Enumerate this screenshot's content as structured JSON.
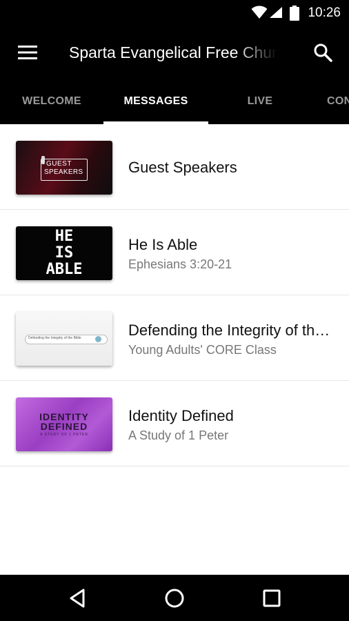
{
  "status_bar": {
    "time": "10:26",
    "icons": [
      "wifi-icon",
      "signal-icon",
      "battery-icon"
    ]
  },
  "app_bar": {
    "title": "Sparta Evangelical Free Church",
    "menu_icon": "menu-icon",
    "search_icon": "search-icon"
  },
  "tabs": [
    {
      "label": "WELCOME",
      "active": false
    },
    {
      "label": "MESSAGES",
      "active": true
    },
    {
      "label": "LIVE",
      "active": false
    },
    {
      "label": "CON",
      "active": false
    }
  ],
  "messages": [
    {
      "title": "Guest Speakers",
      "subtitle": "",
      "thumbnail_text": [
        "GUEST",
        "SPEAKERS"
      ]
    },
    {
      "title": "He Is Able",
      "subtitle": "Ephesians 3:20-21",
      "thumbnail_text": [
        "HE",
        "IS",
        "ABLE"
      ]
    },
    {
      "title": "Defending the Integrity of the Bible",
      "subtitle": "Young Adults' CORE Class",
      "thumbnail_text": [
        "Defending the Integrity of the Bible"
      ]
    },
    {
      "title": "Identity Defined",
      "subtitle": "A Study of 1 Peter",
      "thumbnail_text": [
        "IDENTITY",
        "DEFINED",
        "A STUDY OF 1 PETER"
      ]
    }
  ],
  "nav_bar": {
    "icons": [
      "back-icon",
      "home-icon",
      "recents-icon"
    ]
  },
  "colors": {
    "bar_background": "#000000",
    "tab_inactive": "#9a9a9a",
    "tab_active": "#ffffff",
    "subtitle": "#777777",
    "identity_thumbnail": "#a24ec8",
    "guest_thumbnail": "#6e0f1a"
  }
}
